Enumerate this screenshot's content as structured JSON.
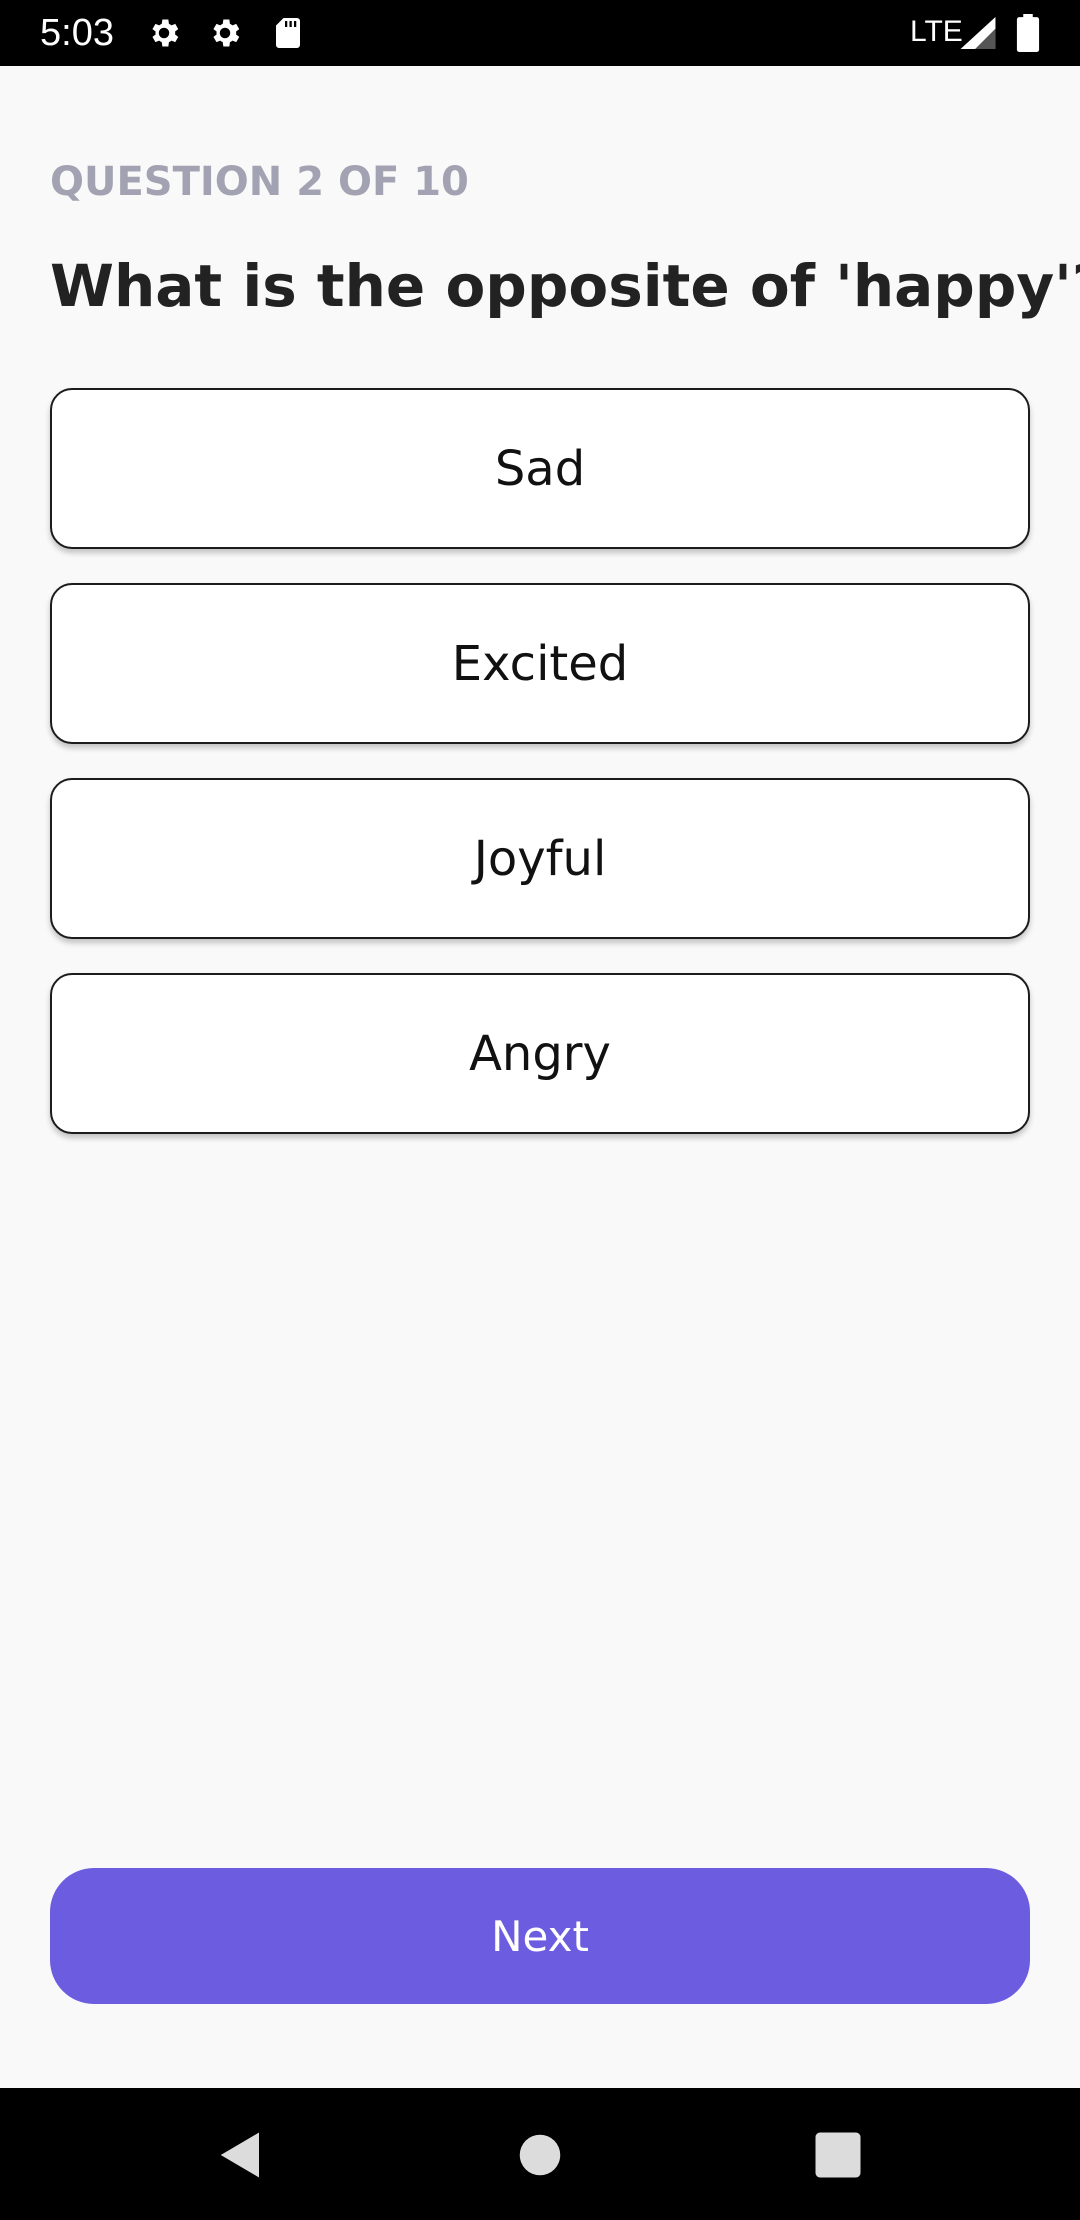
{
  "status_bar": {
    "time": "5:03",
    "network": "LTE",
    "icons": [
      "settings-icon",
      "settings-icon",
      "sd-card-icon",
      "signal-icon",
      "battery-icon"
    ],
    "background": "#000000"
  },
  "quiz": {
    "progress_label": "QUESTION 2 OF 10",
    "question": "What is the opposite of 'happy'?",
    "options": [
      {
        "label": "Sad"
      },
      {
        "label": "Excited"
      },
      {
        "label": "Joyful"
      },
      {
        "label": "Angry"
      }
    ],
    "next_label": "Next"
  },
  "nav_bar": {
    "icons": [
      "back-icon",
      "home-icon",
      "recents-icon"
    ]
  },
  "colors": {
    "accent": "#6c5ce0",
    "background": "#f9f9f9",
    "progress_text": "#a3a2b2",
    "question_text": "#222222"
  }
}
